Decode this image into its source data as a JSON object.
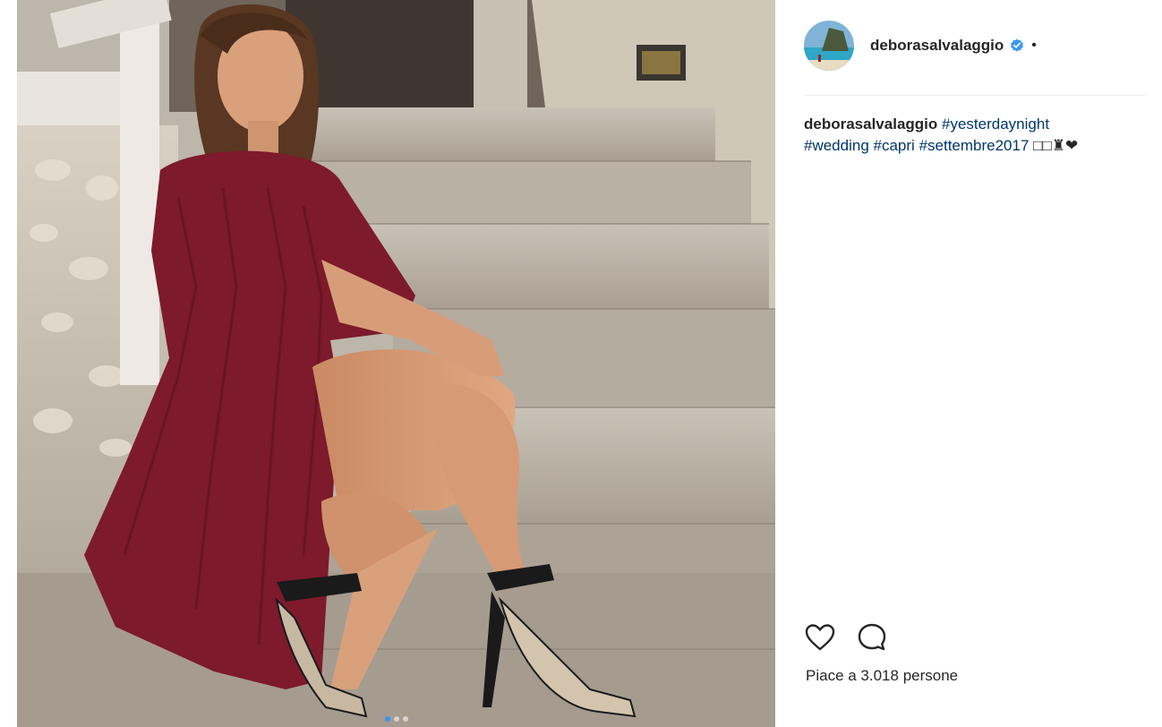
{
  "post": {
    "username": "deborasalvalaggio",
    "separator": "•",
    "caption": {
      "user": "deborasalvalaggio",
      "tags_line1": "#yesterdaynight",
      "tags_line2": [
        "#wedding",
        "#capri",
        "#settembre2017"
      ],
      "emoji": "□□♜❤"
    },
    "likes_text": "Piace a 3.018 persone",
    "carousel_current": 1,
    "carousel_total": 3
  },
  "colors": {
    "accent": "#3897f0",
    "link": "#003569",
    "text": "#262626",
    "dress": "#7d1a2c"
  },
  "icons": {
    "like": "heart-icon",
    "comment": "comment-icon",
    "verified": "verified-badge-icon"
  }
}
